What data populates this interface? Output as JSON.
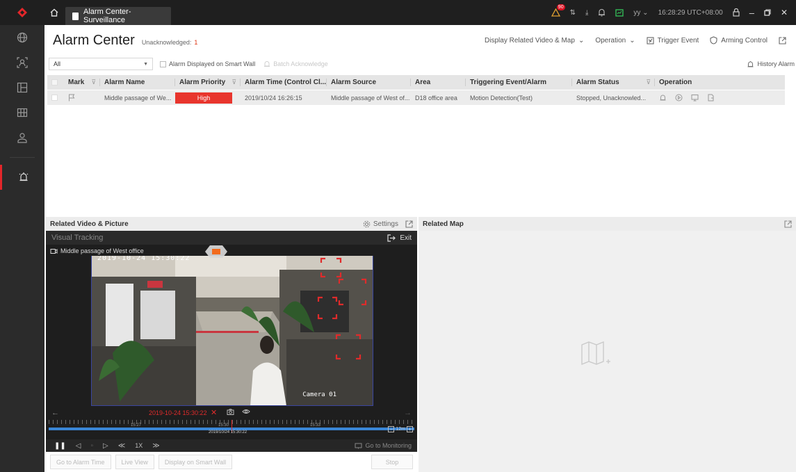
{
  "titlebar": {
    "tab_title": "Alarm Center-Surveillance",
    "alarm_badge": "90",
    "user": "yy",
    "time": "16:28:29 UTC+08:00"
  },
  "header": {
    "title": "Alarm Center",
    "unack_label": "Unacknowledged:",
    "unack_count": "1",
    "actions": {
      "related": "Display Related Video & Map",
      "operation": "Operation",
      "trigger": "Trigger Event",
      "arming": "Arming Control"
    }
  },
  "filter": {
    "selected": "All",
    "smart_wall": "Alarm Displayed on Smart Wall",
    "batch_ack": "Batch Acknowledge",
    "history": "History Alarm"
  },
  "table": {
    "columns": [
      "Mark",
      "Alarm Name",
      "Alarm Priority",
      "Alarm Time (Control Cl...",
      "Alarm Source",
      "Area",
      "Triggering Event/Alarm",
      "Alarm Status",
      "Operation"
    ],
    "rows": [
      {
        "name": "Middle passage of We...",
        "priority": "High",
        "time": "2019/10/24 16:26:15",
        "source": "Middle passage of West of...",
        "area": "D18 office area",
        "trigger": "Motion Detection(Test)",
        "status": "Stopped, Unacknowled..."
      }
    ]
  },
  "video": {
    "pane_title": "Related Video & Picture",
    "settings": "Settings",
    "tracking": "Visual Tracking",
    "exit": "Exit",
    "camera_label": "Middle passage of West office",
    "osd_time": "2019-10-24 15:30:22",
    "camera_name": "Camera 01",
    "playback_time": "2019-10-24 15:30:22",
    "tl_label_left": "15:27",
    "tl_label_mid": "15:30",
    "tl_label_right": "15:33",
    "tl_center": "2019/10/24 15:30:22",
    "zoom_label": "12m",
    "speed": "1X",
    "goto_monitoring": "Go to Monitoring"
  },
  "buttons": {
    "alarm_time": "Go to Alarm Time",
    "live_view": "Live View",
    "smart_wall": "Display on Smart Wall",
    "stop": "Stop"
  },
  "map": {
    "pane_title": "Related Map"
  },
  "colors": {
    "accent_red": "#e3262a",
    "priority_high": "#e8352d",
    "timeline_blue": "#3a86d6"
  }
}
